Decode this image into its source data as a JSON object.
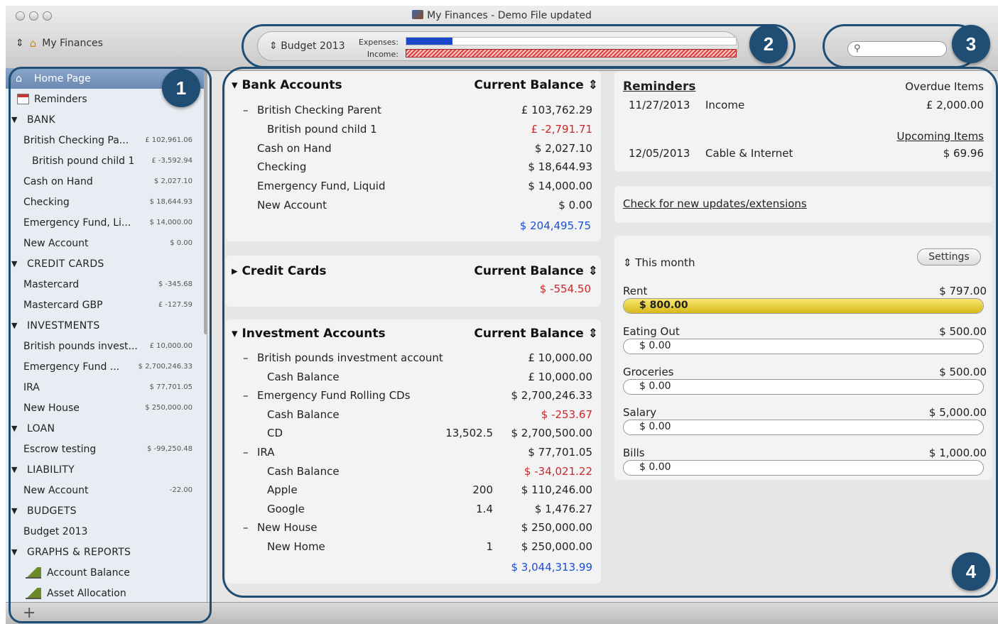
{
  "window": {
    "title": "My Finances - Demo File updated"
  },
  "toolbar": {
    "file_selector": "My Finances",
    "budget_name": "Budget 2013",
    "expenses_label": "Expenses:",
    "income_label": "Income:",
    "expenses_fraction": 0.14,
    "income_fraction": 1.0,
    "search_placeholder": ""
  },
  "sidebar": {
    "home": "Home Page",
    "reminders": "Reminders",
    "groups": [
      {
        "name": "BANK",
        "items": [
          {
            "name": "British Checking Pa...",
            "amount": "£ 102,961.06"
          },
          {
            "name": "British pound child 1",
            "amount": "£ -3,592.94",
            "child": true
          },
          {
            "name": "Cash on Hand",
            "amount": "$ 2,027.10"
          },
          {
            "name": "Checking",
            "amount": "$ 18,644.93"
          },
          {
            "name": "Emergency Fund, Li...",
            "amount": "$ 14,000.00"
          },
          {
            "name": "New Account",
            "amount": "$ 0.00"
          }
        ]
      },
      {
        "name": "CREDIT CARDS",
        "items": [
          {
            "name": "Mastercard",
            "amount": "$ -345.68"
          },
          {
            "name": "Mastercard GBP",
            "amount": "£ -127.59"
          }
        ]
      },
      {
        "name": "INVESTMENTS",
        "items": [
          {
            "name": "British pounds invest...",
            "amount": "£ 10,000.00"
          },
          {
            "name": "Emergency Fund ...",
            "amount": "$ 2,700,246.33"
          },
          {
            "name": "IRA",
            "amount": "$ 77,701.05"
          },
          {
            "name": "New House",
            "amount": "$ 250,000.00"
          }
        ]
      },
      {
        "name": "LOAN",
        "items": [
          {
            "name": "Escrow testing",
            "amount": "$ -99,250.48"
          }
        ]
      },
      {
        "name": "LIABILITY",
        "items": [
          {
            "name": "New Account",
            "amount": "-22.00"
          }
        ]
      },
      {
        "name": "BUDGETS",
        "items": [
          {
            "name": "Budget 2013",
            "amount": ""
          }
        ]
      },
      {
        "name": "GRAPHS & REPORTS",
        "items": [
          {
            "name": "Account Balance",
            "amount": "",
            "graph": true
          },
          {
            "name": "Asset Allocation",
            "amount": "",
            "graph": true
          }
        ]
      }
    ],
    "add_button": "+"
  },
  "bank": {
    "title": "Bank Accounts",
    "col_header": "Current Balance",
    "rows": [
      {
        "dash": "–",
        "name": "British Checking Parent",
        "value": "£ 103,762.29"
      },
      {
        "name": "British pound child 1",
        "value": "£ -2,791.71",
        "neg": true,
        "indent": true
      },
      {
        "name": "Cash on Hand",
        "value": "$ 2,027.10"
      },
      {
        "name": "Checking",
        "value": "$ 18,644.93"
      },
      {
        "name": "Emergency Fund, Liquid",
        "value": "$ 14,000.00"
      },
      {
        "name": "New Account",
        "value": "$ 0.00"
      }
    ],
    "total": "$ 204,495.75"
  },
  "credit": {
    "title": "Credit Cards",
    "col_header": "Current Balance",
    "total": "$ -554.50"
  },
  "investments": {
    "title": "Investment Accounts",
    "col_header": "Current Balance",
    "rows": [
      {
        "dash": "–",
        "name": "British pounds investment account",
        "value": "£ 10,000.00"
      },
      {
        "name": "Cash Balance",
        "value": "£ 10,000.00",
        "indent": true
      },
      {
        "dash": "–",
        "name": "Emergency Fund Rolling CDs",
        "value": "$ 2,700,246.33"
      },
      {
        "name": "Cash Balance",
        "value": "$ -253.67",
        "neg": true,
        "indent": true
      },
      {
        "name": "CD",
        "qty": "13,502.5",
        "value": "$ 2,700,500.00",
        "indent": true
      },
      {
        "dash": "–",
        "name": "IRA",
        "value": "$ 77,701.05"
      },
      {
        "name": "Cash Balance",
        "value": "$ -34,021.22",
        "neg": true,
        "indent": true
      },
      {
        "name": "Apple",
        "qty": "200",
        "value": "$ 110,246.00",
        "indent": true
      },
      {
        "name": "Google",
        "qty": "1.4",
        "value": "$ 1,476.27",
        "indent": true
      },
      {
        "dash": "–",
        "name": "New House",
        "value": "$ 250,000.00"
      },
      {
        "name": "New Home",
        "qty": "1",
        "value": "$ 250,000.00",
        "indent": true
      }
    ],
    "total": "$ 3,044,313.99"
  },
  "reminders": {
    "title": "Reminders",
    "overdue_label": "Overdue Items",
    "overdue": [
      {
        "date": "11/27/2013",
        "name": "Income",
        "amount": "£ 2,000.00"
      }
    ],
    "upcoming_label": "Upcoming Items",
    "upcoming": [
      {
        "date": "12/05/2013",
        "name": "Cable & Internet",
        "amount": "$ 69.96"
      }
    ]
  },
  "updates_link": "Check for new updates/extensions",
  "budget_widget": {
    "period": "This month",
    "settings": "Settings",
    "items": [
      {
        "name": "Rent",
        "budget": "$ 797.00",
        "spent": "$ 800.00",
        "fraction": 1.0
      },
      {
        "name": "Eating Out",
        "budget": "$ 500.00",
        "spent": "$ 0.00",
        "fraction": 0
      },
      {
        "name": "Groceries",
        "budget": "$ 500.00",
        "spent": "$ 0.00",
        "fraction": 0
      },
      {
        "name": "Salary",
        "budget": "$ 5,000.00",
        "spent": "$ 0.00",
        "fraction": 0
      },
      {
        "name": "Bills",
        "budget": "$ 1,000.00",
        "spent": "$ 0.00",
        "fraction": 0
      }
    ]
  },
  "callouts": [
    "1",
    "2",
    "3",
    "4"
  ]
}
